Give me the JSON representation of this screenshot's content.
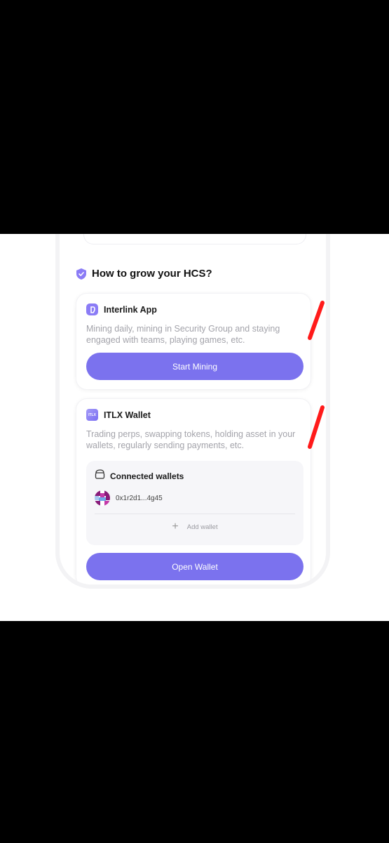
{
  "section": {
    "title": "How to grow your HCS?"
  },
  "interlink": {
    "name": "Interlink App",
    "description": "Mining daily, mining in Security Group and staying engaged with teams, playing games, etc.",
    "button": "Start Mining"
  },
  "itlx": {
    "name": "ITLX Wallet",
    "icon_text": "ITLX",
    "description": "Trading perps, swapping tokens, holding asset in your wallets, regularly sending payments, etc.",
    "connected": {
      "title": "Connected wallets",
      "wallets": [
        {
          "address": "0x1r2d1...4g45"
        }
      ],
      "add_label": "Add wallet"
    },
    "button": "Open Wallet"
  },
  "colors": {
    "accent": "#7b72ee",
    "annotation": "#ff1a1a"
  },
  "icons": [
    "shield-check-icon",
    "interlink-app-icon",
    "itlx-wallet-icon",
    "wallet-icon",
    "wallet-avatar",
    "plus-icon"
  ]
}
